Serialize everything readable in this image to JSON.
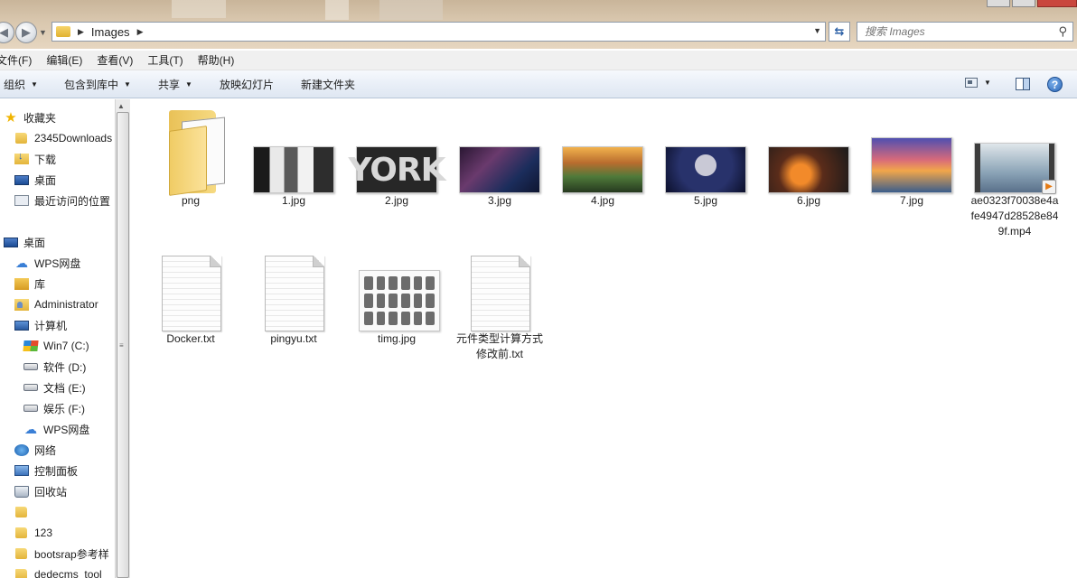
{
  "address": {
    "crumb": "Images"
  },
  "search": {
    "placeholder": "搜索 Images"
  },
  "menu": [
    "文件(F)",
    "编辑(E)",
    "查看(V)",
    "工具(T)",
    "帮助(H)"
  ],
  "commands": {
    "organize": "组织",
    "include_library": "包含到库中",
    "share": "共享",
    "slideshow": "放映幻灯片",
    "new_folder": "新建文件夹"
  },
  "nav": [
    {
      "label": "收藏夹",
      "icon": "star-icon"
    },
    {
      "label": "2345Downloads",
      "icon": "folder-icon"
    },
    {
      "label": "下载",
      "icon": "downloads-folder-icon"
    },
    {
      "label": "桌面",
      "icon": "desktop-icon"
    },
    {
      "label": "最近访问的位置",
      "icon": "recent-places-icon"
    },
    {
      "label": "桌面",
      "icon": "desktop-icon"
    },
    {
      "label": "WPS网盘",
      "icon": "cloud-icon"
    },
    {
      "label": "库",
      "icon": "library-icon"
    },
    {
      "label": "Administrator",
      "icon": "user-folder-icon"
    },
    {
      "label": "计算机",
      "icon": "computer-icon"
    },
    {
      "label": "Win7 (C:)",
      "icon": "windows-drive-icon"
    },
    {
      "label": "软件 (D:)",
      "icon": "drive-icon"
    },
    {
      "label": "文档 (E:)",
      "icon": "drive-icon"
    },
    {
      "label": "娱乐 (F:)",
      "icon": "drive-icon"
    },
    {
      "label": "WPS网盘",
      "icon": "cloud-icon"
    },
    {
      "label": "网络",
      "icon": "network-icon"
    },
    {
      "label": "控制面板",
      "icon": "control-panel-icon"
    },
    {
      "label": "回收站",
      "icon": "recycle-bin-icon"
    },
    {
      "label": "",
      "icon": "folder-icon"
    },
    {
      "label": "123",
      "icon": "folder-icon"
    },
    {
      "label": "bootsrap参考样",
      "icon": "folder-icon"
    },
    {
      "label": "dedecms_tool",
      "icon": "folder-icon"
    }
  ],
  "files": [
    {
      "name": "png",
      "kind": "folder"
    },
    {
      "name": "1.jpg",
      "kind": "image"
    },
    {
      "name": "2.jpg",
      "kind": "image",
      "overlay": "YORK"
    },
    {
      "name": "3.jpg",
      "kind": "image"
    },
    {
      "name": "4.jpg",
      "kind": "image"
    },
    {
      "name": "5.jpg",
      "kind": "image"
    },
    {
      "name": "6.jpg",
      "kind": "image"
    },
    {
      "name": "7.jpg",
      "kind": "image"
    },
    {
      "name": "ae0323f70038e4afe4947d28528e849f.mp4",
      "kind": "video"
    },
    {
      "name": "Docker.txt",
      "kind": "text"
    },
    {
      "name": "pingyu.txt",
      "kind": "text"
    },
    {
      "name": "timg.jpg",
      "kind": "image-icons"
    },
    {
      "name": "元件类型计算方式修改前.txt",
      "kind": "text"
    }
  ],
  "colors": {
    "command_bar": "#e8eef7",
    "title_strip": "#d8c6ad",
    "close_button": "#c9463d"
  }
}
